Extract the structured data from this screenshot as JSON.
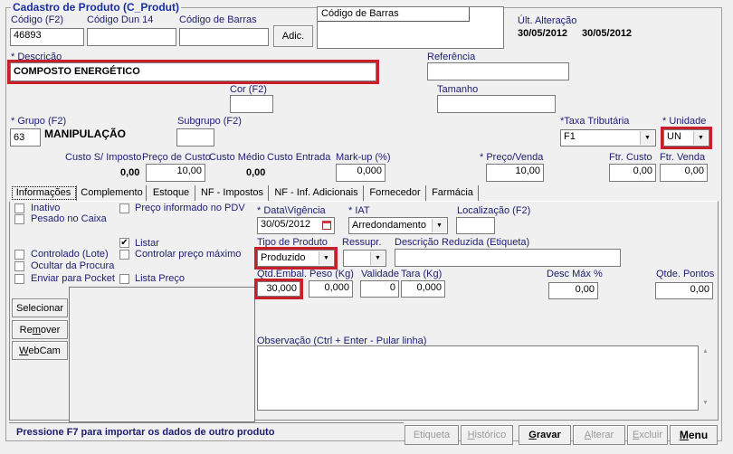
{
  "window": {
    "title": "Cadastro de Produto (C_Produt)"
  },
  "header": {
    "codigo_label": "Código (F2)",
    "codigo_value": "46893",
    "dun14_label": "Código Dun 14",
    "dun14_value": "",
    "barras_label": "Código de Barras",
    "barras_value": "",
    "adic_button": "Adic.",
    "barras_list_header": "Código de Barras",
    "ult_alteracao_label": "Últ. Alteração",
    "ult_alteracao_date1": "30/05/2012",
    "ult_alteracao_date2": "30/05/2012"
  },
  "descricao": {
    "label": "* Descrição",
    "value": "COMPOSTO ENERGÉTICO"
  },
  "referencia": {
    "label": "Referência",
    "value": ""
  },
  "cor": {
    "label": "Cor (F2)",
    "value": ""
  },
  "tamanho": {
    "label": "Tamanho",
    "value": ""
  },
  "grupo": {
    "label": "* Grupo (F2)",
    "value": "63",
    "name": "MANIPULAÇÃO"
  },
  "subgrupo": {
    "label": "Subgrupo (F2)",
    "value": ""
  },
  "taxa": {
    "label": "*Taxa Tributária",
    "value": "F1"
  },
  "unidade": {
    "label": "* Unidade",
    "value": "UN"
  },
  "custos": {
    "custo_s_imposto_label": "Custo S/ Imposto",
    "custo_s_imposto_value": "0,00",
    "preco_custo_label": "Preço de Custo",
    "preco_custo_value": "10,00",
    "custo_medio_label": "Custo Médio",
    "custo_medio_value": "0,00",
    "custo_entrada_label": "Custo Entrada",
    "markup_label": "Mark-up (%)",
    "markup_value": "0,000",
    "preco_venda_label": "* Preço/Venda",
    "preco_venda_value": "10,00",
    "ftr_custo_label": "Ftr. Custo",
    "ftr_custo_value": "0,00",
    "ftr_venda_label": "Ftr. Venda",
    "ftr_venda_value": "0,00"
  },
  "tabs": [
    {
      "label": "Informações",
      "active": true
    },
    {
      "label": "Complemento"
    },
    {
      "label": "Estoque"
    },
    {
      "label": "NF - Impostos"
    },
    {
      "label": "NF - Inf. Adicionais"
    },
    {
      "label": "Fornecedor"
    },
    {
      "label": "Farmácia"
    }
  ],
  "checkboxes": {
    "inativo": {
      "label": "Inativo",
      "checked": false
    },
    "pesado": {
      "label": "Pesado no Caixa",
      "checked": false
    },
    "preco_pdv": {
      "label": "Preço informado no PDV",
      "checked": false
    },
    "listar": {
      "label": "Listar",
      "checked": true,
      "mark": "✔"
    },
    "controlado": {
      "label": "Controlado (Lote)",
      "checked": false
    },
    "controlar_preco": {
      "label": "Controlar preço máximo",
      "checked": false
    },
    "ocultar": {
      "label": "Ocultar da Procura",
      "checked": false
    },
    "pocket": {
      "label": "Enviar para Pocket",
      "checked": false
    },
    "lista_preco": {
      "label": "Lista Preço",
      "checked": false
    }
  },
  "info": {
    "data_vigencia_label": "* Data\\Vigência",
    "data_vigencia_value": "30/05/2012",
    "iat_label": "* IAT",
    "iat_value": "Arredondamento",
    "localizacao_label": "Localização (F2)",
    "localizacao_value": "",
    "tipo_produto_label": "Tipo de Produto",
    "tipo_produto_value": "Produzido",
    "ressupr_label": "Ressupr.",
    "ressupr_value": "",
    "desc_reduzida_label": "Descrição Reduzida (Etiqueta)",
    "desc_reduzida_value": "",
    "qtd_embal_label": "Qtd.Embal.",
    "qtd_embal_value": "30,000",
    "peso_label": "Peso (Kg)",
    "peso_value": "0,000",
    "validade_label": "Validade",
    "validade_value": "0",
    "tara_label": "Tara (Kg)",
    "tara_value": "0,000",
    "desc_max_label": "Desc Máx %",
    "desc_max_value": "0,00",
    "qtde_pontos_label": "Qtde. Pontos",
    "qtde_pontos_value": "0,00",
    "observacao_label": "Observação (Ctrl + Enter - Pular linha)",
    "observacao_value": ""
  },
  "image_buttons": {
    "selecionar": "Selecionar",
    "remover_pre": "Re",
    "remover_u": "m",
    "remover_post": "over",
    "webcam_u": "W",
    "webcam_post": "ebCam"
  },
  "footer": {
    "hint": "Pressione F7 para importar os dados de outro produto",
    "etiqueta": "Etiqueta",
    "historico_u": "H",
    "historico_post": "istórico",
    "gravar_u": "G",
    "gravar_post": "ravar",
    "alterar_u": "A",
    "alterar_post": "lterar",
    "excluir_u": "E",
    "excluir_post": "xcluir",
    "menu_u": "M",
    "menu_post": "enu"
  },
  "icons": {
    "dropdown": "▼",
    "calendar": "calendar-icon",
    "scroll_up": "▲",
    "scroll_down": "▼"
  },
  "colors": {
    "label_blue": "#1c1c70",
    "title_blue": "#1a2fa0",
    "highlight_red": "#c8202a"
  }
}
